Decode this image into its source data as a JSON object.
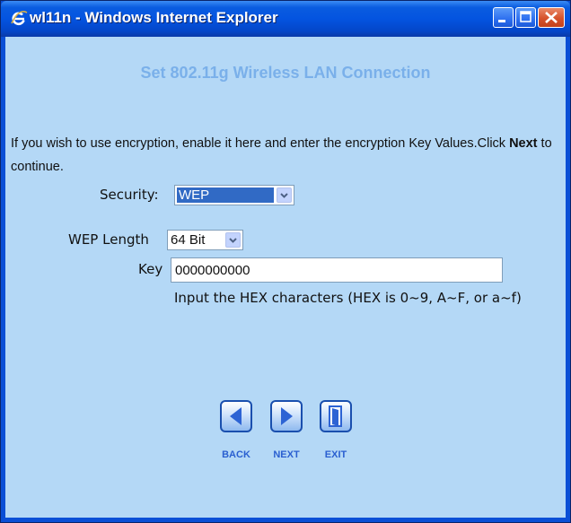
{
  "window": {
    "title": "wl11n - Windows Internet Explorer",
    "app_icon": "ie-icon",
    "controls": [
      "minimize-icon",
      "maximize-icon",
      "close-icon"
    ]
  },
  "page": {
    "heading": "Set 802.11g Wireless LAN Connection",
    "intro_before": "If you wish to use encryption, enable it here and enter the encryption Key Values.Click ",
    "intro_bold": "Next",
    "intro_after": " to continue."
  },
  "form": {
    "security_label": "Security:",
    "security_value": "WEP",
    "wep_length_label": "WEP Length",
    "wep_length_value": "64 Bit",
    "key_label": "Key",
    "key_value": "0000000000",
    "hint": "Input the HEX characters (HEX is 0~9, A~F, or a~f)"
  },
  "nav": {
    "back_label": "BACK",
    "next_label": "NEXT",
    "exit_label": "EXIT"
  },
  "colors": {
    "client_background": "#b4d8f6",
    "heading": "#7ab0ea",
    "title_bar": "#0454e0",
    "selection": "#316ac5",
    "nav_label": "#2a5fd0"
  }
}
